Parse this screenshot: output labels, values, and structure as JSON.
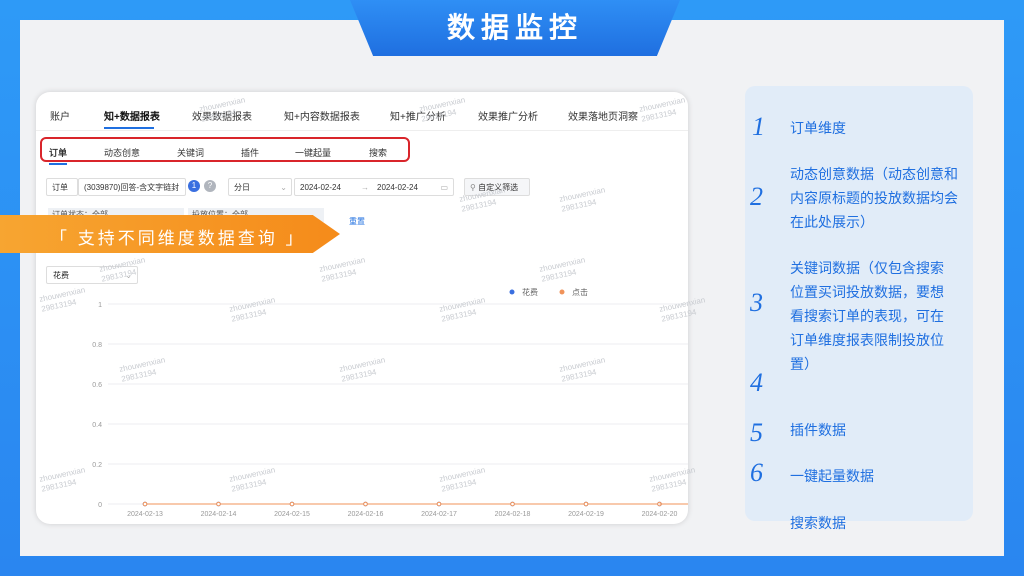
{
  "title": "数据监控",
  "topnav": [
    "账户",
    "知+数据报表",
    "效果数据报表",
    "知+内容数据报表",
    "知+推广分析",
    "效果推广分析",
    "效果落地页洞察"
  ],
  "subnav": [
    "订单",
    "动态创意",
    "关键词",
    "插件",
    "一键起量",
    "搜索"
  ],
  "filters": {
    "order_label": "订单",
    "order_value": "(3039870)回答-含文字链封",
    "badge_count": "1",
    "granularity": "分日",
    "date_start": "2024-02-24",
    "date_sep": "→",
    "date_end": "2024-02-24",
    "custom_filter": "自定义筛选",
    "status_filter": "订单状态：全部",
    "position_filter": "投放位置：全部",
    "reset": "重置"
  },
  "callout": "「 支持不同维度数据查询 」",
  "metric_select": "花费",
  "chart_data": {
    "type": "line",
    "x": [
      "2024-02-13",
      "2024-02-14",
      "2024-02-15",
      "2024-02-16",
      "2024-02-17",
      "2024-02-18",
      "2024-02-19",
      "2024-02-20"
    ],
    "series": [
      {
        "name": "花费",
        "values": [
          0,
          0,
          0,
          0,
          0,
          0,
          0,
          0
        ],
        "color": "#3a6fe0"
      },
      {
        "name": "点击",
        "values": [
          0,
          0,
          0,
          0,
          0,
          0,
          0,
          0
        ],
        "color": "#f0935a"
      }
    ],
    "yticks": [
      "1",
      "0.8",
      "0.6",
      "0.4",
      "0.2",
      "0"
    ],
    "ylim": [
      0,
      1
    ],
    "legend": "top-right",
    "grid": true
  },
  "side_items": [
    {
      "num": "1",
      "text": "订单维度"
    },
    {
      "num": "2",
      "text": "动态创意数据（动态创意和内容原标题的投放数据均会在此处展示）"
    },
    {
      "num": "3",
      "text": "关键词数据（仅包含搜索位置买词投放数据，要想看搜索订单的表现，可在订单维度报表限制投放位置）"
    },
    {
      "num": "4",
      "text": ""
    },
    {
      "num": "5",
      "text": "插件数据"
    },
    {
      "num": "6",
      "text": "一键起量数据"
    },
    {
      "num": "",
      "text": "搜索数据"
    }
  ],
  "watermark": {
    "line1": "zhouwenxian",
    "line2": "29813194"
  }
}
